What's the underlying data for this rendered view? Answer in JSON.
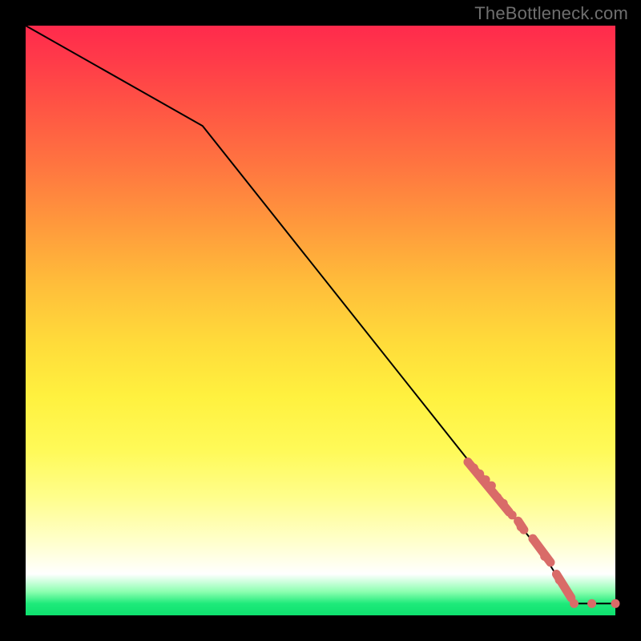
{
  "watermark": "TheBottleneck.com",
  "chart_data": {
    "type": "line",
    "title": "",
    "xlabel": "",
    "ylabel": "",
    "xlim": [
      0,
      100
    ],
    "ylim": [
      0,
      100
    ],
    "series": [
      {
        "name": "curve",
        "x": [
          0,
          30,
          88,
          93,
          100
        ],
        "values": [
          100,
          83,
          10,
          2,
          2
        ]
      }
    ],
    "highlighted_points": {
      "x": [
        75,
        76,
        77,
        78,
        79,
        80,
        81,
        82.5,
        84,
        86,
        88,
        90.5,
        93,
        96,
        100
      ],
      "values": [
        26,
        25,
        24,
        23,
        22,
        20,
        19,
        17,
        15,
        13,
        10,
        6,
        2,
        2,
        2
      ]
    },
    "highlighted_segments": [
      {
        "x0": 75,
        "y0": 26,
        "x1": 82,
        "y1": 17.5
      },
      {
        "x0": 83.5,
        "y0": 16,
        "x1": 84.5,
        "y1": 14.5
      },
      {
        "x0": 86,
        "y0": 13,
        "x1": 89,
        "y1": 9
      },
      {
        "x0": 90,
        "y0": 7,
        "x1": 92.5,
        "y1": 3
      }
    ],
    "colors": {
      "line": "#000000",
      "marker": "#d96b68",
      "gradient_top": "#ff2a4c",
      "gradient_mid": "#fff13f",
      "gradient_bottom": "#0ee06e",
      "background": "#000000"
    }
  }
}
